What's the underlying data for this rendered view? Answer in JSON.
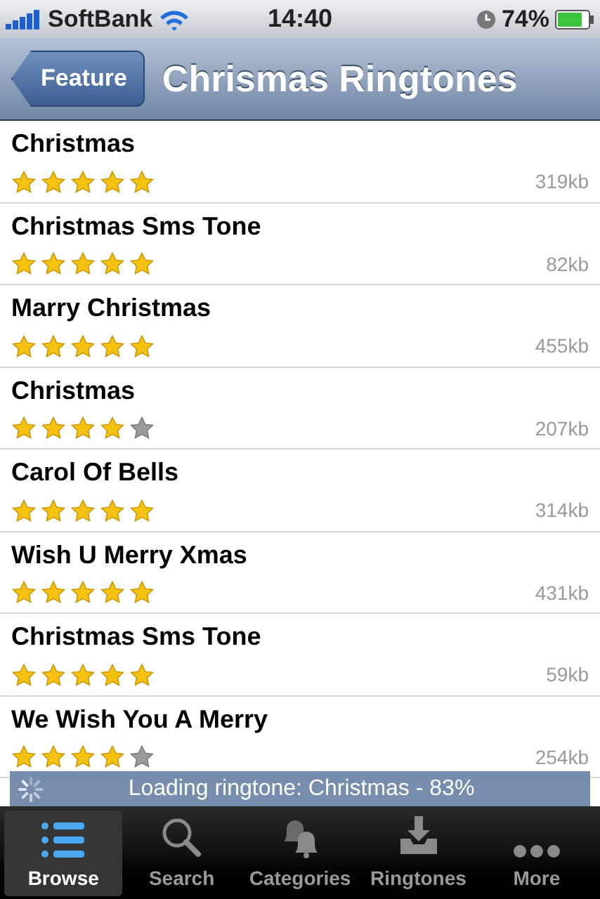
{
  "status_bar": {
    "carrier": "SoftBank",
    "time": "14:40",
    "battery": "74%"
  },
  "nav": {
    "back": "Feature",
    "title": "Chrismas Ringtones"
  },
  "ringtones": [
    {
      "title": "Christmas",
      "stars": 5,
      "size": "319kb"
    },
    {
      "title": "Christmas Sms Tone",
      "stars": 5,
      "size": "82kb"
    },
    {
      "title": "Marry Christmas",
      "stars": 5,
      "size": "455kb"
    },
    {
      "title": "Christmas",
      "stars": 4,
      "size": "207kb"
    },
    {
      "title": "Carol Of Bells",
      "stars": 5,
      "size": "314kb"
    },
    {
      "title": "Wish U Merry Xmas",
      "stars": 5,
      "size": "431kb"
    },
    {
      "title": "Christmas Sms Tone",
      "stars": 5,
      "size": "59kb"
    },
    {
      "title": "We Wish You A Merry",
      "stars": 4,
      "size": "254kb"
    }
  ],
  "loading": "Loading ringtone: Christmas - 83%",
  "tabs": [
    {
      "label": "Browse",
      "kind": "list",
      "selected": true
    },
    {
      "label": "Search",
      "kind": "search",
      "selected": false
    },
    {
      "label": "Categories",
      "kind": "bells",
      "selected": false
    },
    {
      "label": "Ringtones",
      "kind": "inbox",
      "selected": false
    },
    {
      "label": "More",
      "kind": "more",
      "selected": false
    }
  ]
}
